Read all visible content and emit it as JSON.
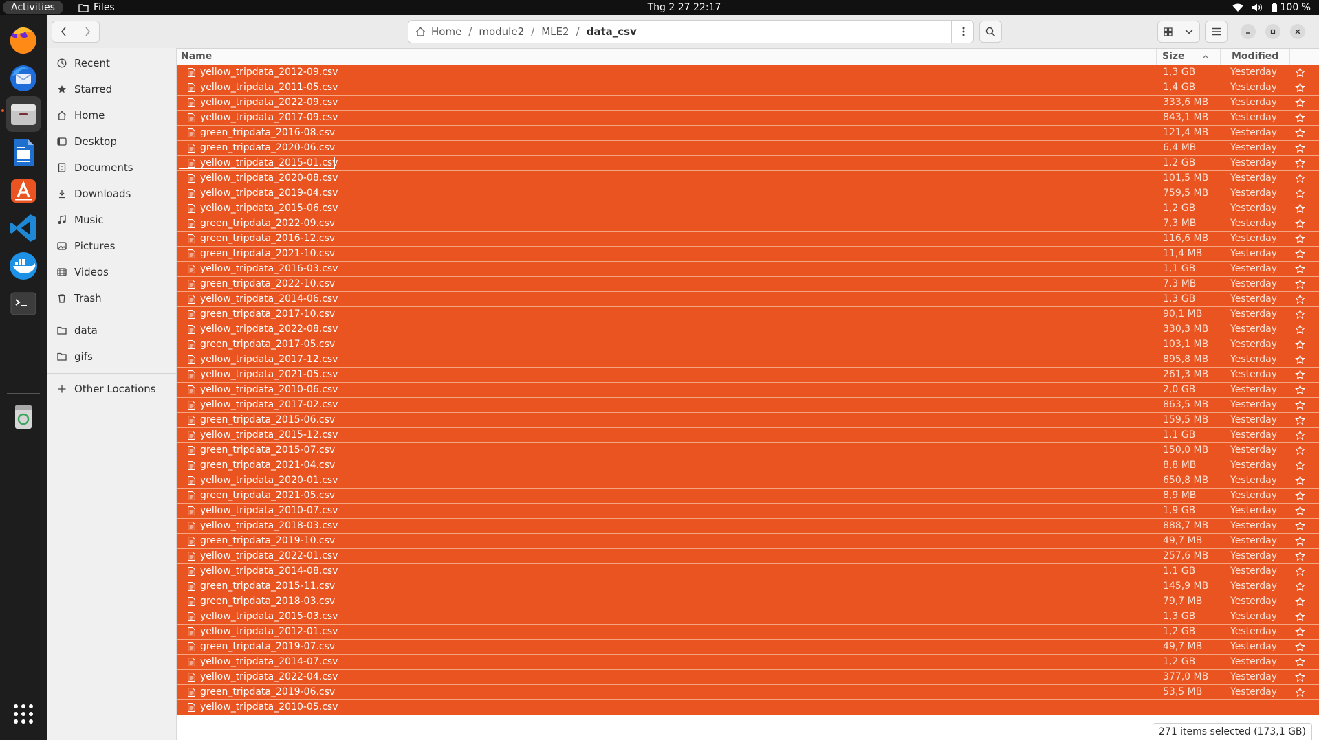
{
  "topbar": {
    "activities": "Activities",
    "app_name": "Files",
    "clock": "Thg 2 27  22:17",
    "battery": "100 %"
  },
  "dock": {
    "apps": [
      "firefox-icon",
      "thunderbird-icon",
      "files-icon",
      "writer-icon",
      "app-center-icon",
      "vscode-icon",
      "docker-icon",
      "terminal-icon",
      "trash-icon",
      "show-apps-icon"
    ]
  },
  "header": {
    "path": [
      "Home",
      "module2",
      "MLE2",
      "data_csv"
    ]
  },
  "sidebar": {
    "places": [
      {
        "label": "Recent",
        "icon": "clock-icon"
      },
      {
        "label": "Starred",
        "icon": "star-icon"
      },
      {
        "label": "Home",
        "icon": "home-icon"
      },
      {
        "label": "Desktop",
        "icon": "desktop-icon"
      },
      {
        "label": "Documents",
        "icon": "document-icon"
      },
      {
        "label": "Downloads",
        "icon": "download-icon"
      },
      {
        "label": "Music",
        "icon": "music-icon"
      },
      {
        "label": "Pictures",
        "icon": "picture-icon"
      },
      {
        "label": "Videos",
        "icon": "video-icon"
      },
      {
        "label": "Trash",
        "icon": "trash-icon"
      }
    ],
    "bookmarks": [
      {
        "label": "data",
        "icon": "folder-icon"
      },
      {
        "label": "gifs",
        "icon": "folder-icon"
      }
    ],
    "other": {
      "label": "Other Locations",
      "icon": "plus-icon"
    }
  },
  "columns": {
    "name": "Name",
    "size": "Size",
    "modified": "Modified"
  },
  "files": [
    {
      "name": "yellow_tripdata_2012-09.csv",
      "size": "1,3 GB",
      "modified": "Yesterday"
    },
    {
      "name": "yellow_tripdata_2011-05.csv",
      "size": "1,4 GB",
      "modified": "Yesterday"
    },
    {
      "name": "yellow_tripdata_2022-09.csv",
      "size": "333,6 MB",
      "modified": "Yesterday"
    },
    {
      "name": "yellow_tripdata_2017-09.csv",
      "size": "843,1 MB",
      "modified": "Yesterday"
    },
    {
      "name": "green_tripdata_2016-08.csv",
      "size": "121,4 MB",
      "modified": "Yesterday"
    },
    {
      "name": "green_tripdata_2020-06.csv",
      "size": "6,4 MB",
      "modified": "Yesterday"
    },
    {
      "name": "yellow_tripdata_2015-01.csv",
      "size": "1,2 GB",
      "modified": "Yesterday"
    },
    {
      "name": "yellow_tripdata_2020-08.csv",
      "size": "101,5 MB",
      "modified": "Yesterday"
    },
    {
      "name": "yellow_tripdata_2019-04.csv",
      "size": "759,5 MB",
      "modified": "Yesterday"
    },
    {
      "name": "yellow_tripdata_2015-06.csv",
      "size": "1,2 GB",
      "modified": "Yesterday"
    },
    {
      "name": "green_tripdata_2022-09.csv",
      "size": "7,3 MB",
      "modified": "Yesterday"
    },
    {
      "name": "green_tripdata_2016-12.csv",
      "size": "116,6 MB",
      "modified": "Yesterday"
    },
    {
      "name": "green_tripdata_2021-10.csv",
      "size": "11,4 MB",
      "modified": "Yesterday"
    },
    {
      "name": "yellow_tripdata_2016-03.csv",
      "size": "1,1 GB",
      "modified": "Yesterday"
    },
    {
      "name": "green_tripdata_2022-10.csv",
      "size": "7,3 MB",
      "modified": "Yesterday"
    },
    {
      "name": "yellow_tripdata_2014-06.csv",
      "size": "1,3 GB",
      "modified": "Yesterday"
    },
    {
      "name": "green_tripdata_2017-10.csv",
      "size": "90,1 MB",
      "modified": "Yesterday"
    },
    {
      "name": "yellow_tripdata_2022-08.csv",
      "size": "330,3 MB",
      "modified": "Yesterday"
    },
    {
      "name": "green_tripdata_2017-05.csv",
      "size": "103,1 MB",
      "modified": "Yesterday"
    },
    {
      "name": "yellow_tripdata_2017-12.csv",
      "size": "895,8 MB",
      "modified": "Yesterday"
    },
    {
      "name": "yellow_tripdata_2021-05.csv",
      "size": "261,3 MB",
      "modified": "Yesterday"
    },
    {
      "name": "yellow_tripdata_2010-06.csv",
      "size": "2,0 GB",
      "modified": "Yesterday"
    },
    {
      "name": "yellow_tripdata_2017-02.csv",
      "size": "863,5 MB",
      "modified": "Yesterday"
    },
    {
      "name": "green_tripdata_2015-06.csv",
      "size": "159,5 MB",
      "modified": "Yesterday"
    },
    {
      "name": "yellow_tripdata_2015-12.csv",
      "size": "1,1 GB",
      "modified": "Yesterday"
    },
    {
      "name": "green_tripdata_2015-07.csv",
      "size": "150,0 MB",
      "modified": "Yesterday"
    },
    {
      "name": "green_tripdata_2021-04.csv",
      "size": "8,8 MB",
      "modified": "Yesterday"
    },
    {
      "name": "yellow_tripdata_2020-01.csv",
      "size": "650,8 MB",
      "modified": "Yesterday"
    },
    {
      "name": "green_tripdata_2021-05.csv",
      "size": "8,9 MB",
      "modified": "Yesterday"
    },
    {
      "name": "yellow_tripdata_2010-07.csv",
      "size": "1,9 GB",
      "modified": "Yesterday"
    },
    {
      "name": "yellow_tripdata_2018-03.csv",
      "size": "888,7 MB",
      "modified": "Yesterday"
    },
    {
      "name": "green_tripdata_2019-10.csv",
      "size": "49,7 MB",
      "modified": "Yesterday"
    },
    {
      "name": "yellow_tripdata_2022-01.csv",
      "size": "257,6 MB",
      "modified": "Yesterday"
    },
    {
      "name": "yellow_tripdata_2014-08.csv",
      "size": "1,1 GB",
      "modified": "Yesterday"
    },
    {
      "name": "green_tripdata_2015-11.csv",
      "size": "145,9 MB",
      "modified": "Yesterday"
    },
    {
      "name": "green_tripdata_2018-03.csv",
      "size": "79,7 MB",
      "modified": "Yesterday"
    },
    {
      "name": "yellow_tripdata_2015-03.csv",
      "size": "1,3 GB",
      "modified": "Yesterday"
    },
    {
      "name": "yellow_tripdata_2012-01.csv",
      "size": "1,2 GB",
      "modified": "Yesterday"
    },
    {
      "name": "green_tripdata_2019-07.csv",
      "size": "49,7 MB",
      "modified": "Yesterday"
    },
    {
      "name": "yellow_tripdata_2014-07.csv",
      "size": "1,2 GB",
      "modified": "Yesterday"
    },
    {
      "name": "yellow_tripdata_2022-04.csv",
      "size": "377,0 MB",
      "modified": "Yesterday"
    },
    {
      "name": "green_tripdata_2019-06.csv",
      "size": "53,5 MB",
      "modified": "Yesterday"
    },
    {
      "name": "yellow_tripdata_2010-05.csv",
      "size": "",
      "modified": ""
    }
  ],
  "focused_file": "yellow_tripdata_2015-01.csv",
  "status": "271 items selected (173,1 GB)",
  "colors": {
    "selection": "#e95420",
    "dock": "#1d1d1d",
    "topbar": "#111111"
  }
}
